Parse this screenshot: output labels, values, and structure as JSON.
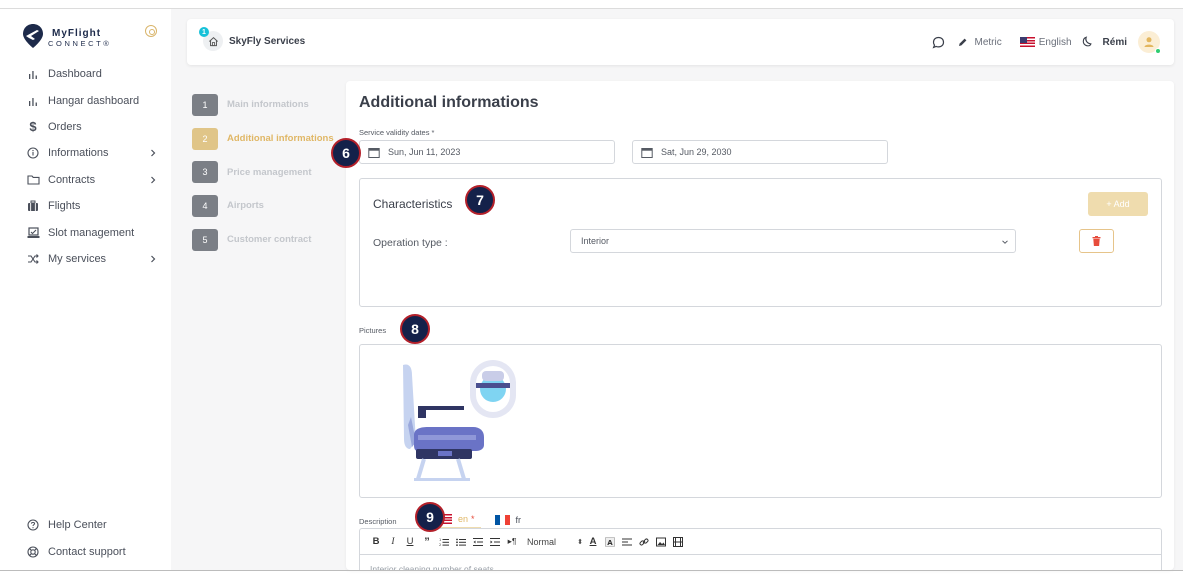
{
  "sidebar": {
    "logo_title": "MyFlight",
    "logo_sub": "CONNECT®",
    "items": [
      {
        "label": "Dashboard",
        "icon": "bar-chart-icon",
        "chevron": false
      },
      {
        "label": "Hangar dashboard",
        "icon": "bar-chart-icon",
        "chevron": false
      },
      {
        "label": "Orders",
        "icon": "dollar-icon",
        "chevron": false
      },
      {
        "label": "Informations",
        "icon": "info-icon",
        "chevron": true
      },
      {
        "label": "Contracts",
        "icon": "folder-icon",
        "chevron": true
      },
      {
        "label": "Flights",
        "icon": "luggage-icon",
        "chevron": false
      },
      {
        "label": "Slot management",
        "icon": "slot-icon",
        "chevron": false
      },
      {
        "label": "My services",
        "icon": "shuffle-icon",
        "chevron": true
      }
    ],
    "bottom_items": [
      {
        "label": "Help Center",
        "icon": "help-icon"
      },
      {
        "label": "Contact support",
        "icon": "lifebuoy-icon"
      }
    ]
  },
  "topbar": {
    "home_badge": "1",
    "company": "SkyFly Services",
    "units": "Metric",
    "language": "English",
    "user": "Rémi"
  },
  "stepper": [
    {
      "num": "1",
      "label": "Main informations",
      "active": false
    },
    {
      "num": "2",
      "label": "Additional informations",
      "active": true
    },
    {
      "num": "3",
      "label": "Price management",
      "active": false
    },
    {
      "num": "4",
      "label": "Airports",
      "active": false
    },
    {
      "num": "5",
      "label": "Customer contract",
      "active": false
    }
  ],
  "form": {
    "title": "Additional informations",
    "validity_label": "Service validity dates *",
    "start_date": "Sun, Jun 11, 2023",
    "end_date": "Sat, Jun 29, 2030",
    "characteristics": {
      "title": "Characteristics",
      "add_label": "+ Add",
      "operation_label": "Operation type :",
      "operation_value": "Interior"
    },
    "pictures_label": "Pictures",
    "description_label": "Description",
    "lang_tabs": [
      {
        "code": "en",
        "required": "*",
        "active": true
      },
      {
        "code": "fr",
        "required": "",
        "active": false
      }
    ],
    "editor": {
      "heading_select": "Normal",
      "text": "Interior cleaning number of seats"
    }
  },
  "markers": [
    "6",
    "7",
    "8",
    "9"
  ],
  "colors": {
    "accent_gold": "#e0b766",
    "marker_fill": "#14214a",
    "marker_ring": "#b3202a",
    "delete_red": "#e74c3c",
    "online_green": "#2ecc71"
  }
}
